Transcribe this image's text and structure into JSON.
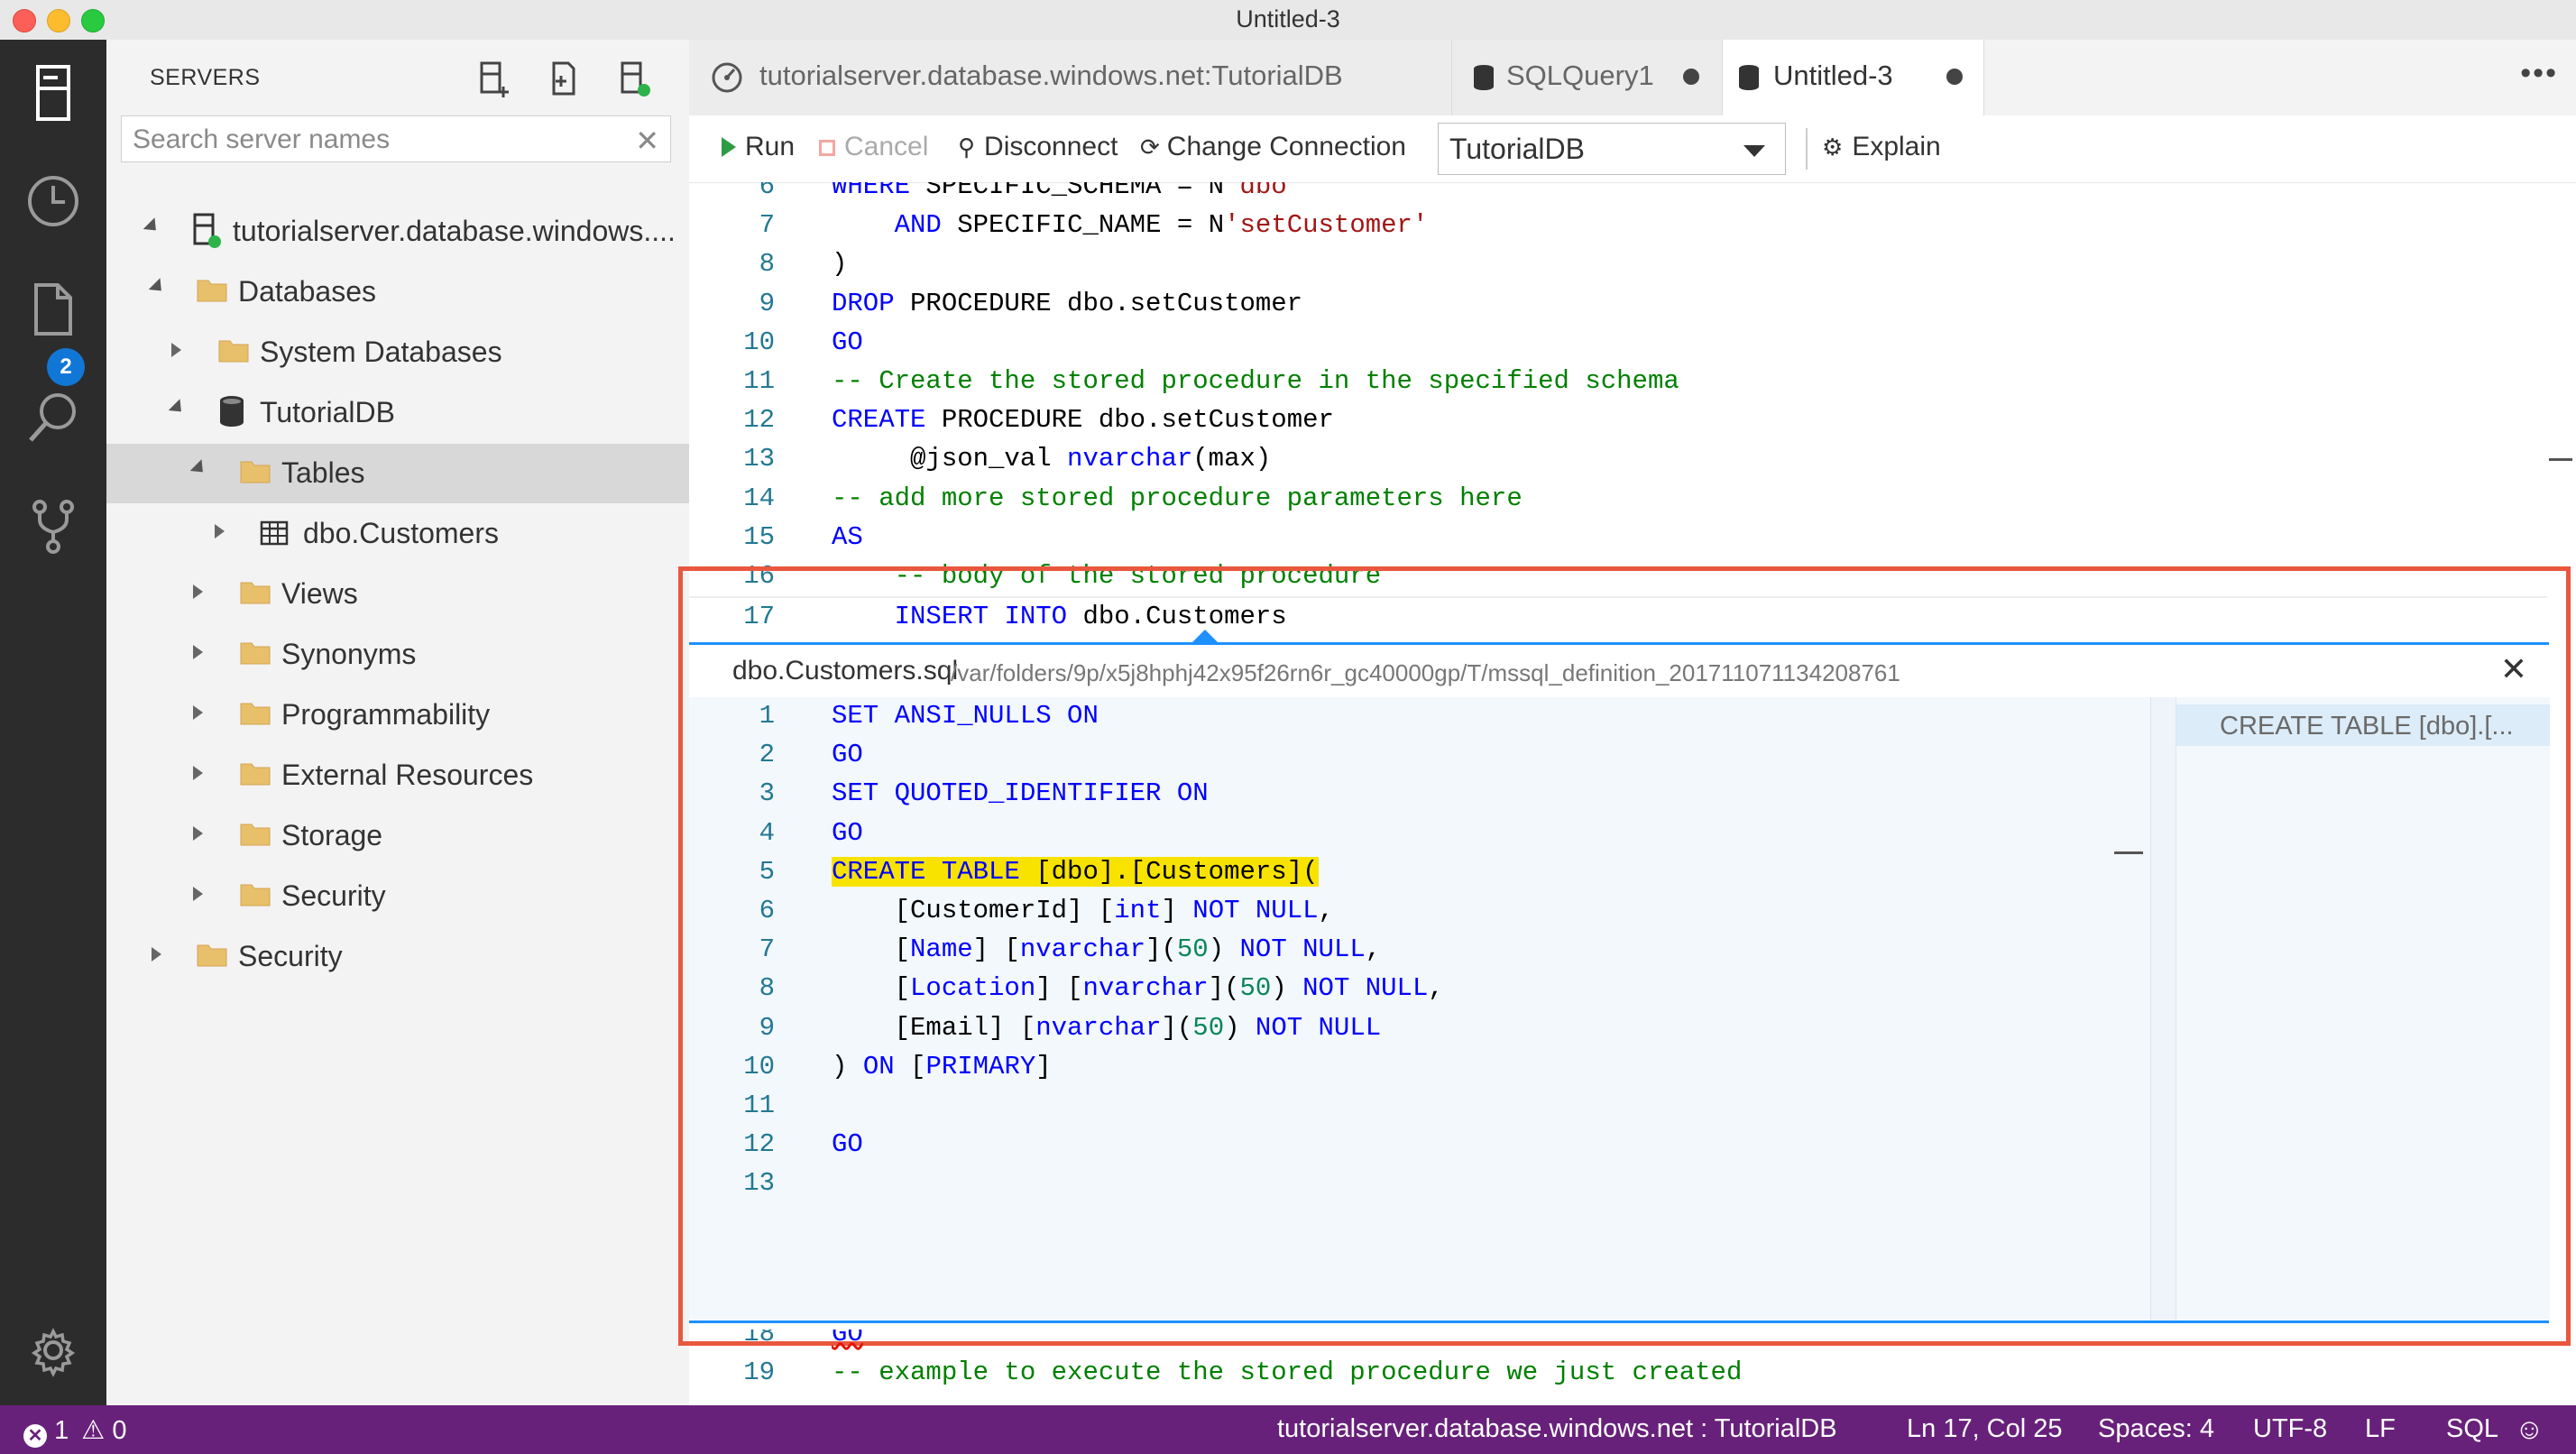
{
  "window": {
    "title": "Untitled-3"
  },
  "activity": {
    "badge": "2",
    "icons": [
      "servers-icon",
      "history-icon",
      "files-icon",
      "search-icon",
      "source-control-icon",
      "settings-gear-icon"
    ]
  },
  "sidebar": {
    "title": "SERVERS",
    "search_placeholder": "Search server names",
    "tree": [
      {
        "label": "tutorialserver.database.windows....",
        "icon": "server-connected-icon"
      },
      {
        "label": "Databases",
        "icon": "folder-icon"
      },
      {
        "label": "System Databases",
        "icon": "folder-icon"
      },
      {
        "label": "TutorialDB",
        "icon": "database-icon"
      },
      {
        "label": "Tables",
        "icon": "folder-icon"
      },
      {
        "label": "dbo.Customers",
        "icon": "table-icon"
      },
      {
        "label": "Views",
        "icon": "folder-icon"
      },
      {
        "label": "Synonyms",
        "icon": "folder-icon"
      },
      {
        "label": "Programmability",
        "icon": "folder-icon"
      },
      {
        "label": "External Resources",
        "icon": "folder-icon"
      },
      {
        "label": "Storage",
        "icon": "folder-icon"
      },
      {
        "label": "Security",
        "icon": "folder-icon"
      },
      {
        "label": "Security",
        "icon": "folder-icon"
      }
    ]
  },
  "tabs": [
    {
      "label": "tutorialserver.database.windows.net:TutorialDB",
      "icon": "dashboard-icon"
    },
    {
      "label": "SQLQuery1",
      "icon": "database-icon",
      "dirty": true
    },
    {
      "label": "Untitled-3",
      "icon": "database-icon",
      "dirty": true,
      "active": true
    }
  ],
  "toolbar": {
    "run": "Run",
    "cancel": "Cancel",
    "disconnect": "Disconnect",
    "change_connection": "Change Connection",
    "database": "TutorialDB",
    "explain": "Explain"
  },
  "editor_top": [
    {
      "n": "6",
      "parts": [
        [
          "kw",
          "WHERE "
        ],
        [
          "plain",
          "SPECIFIC_SCHEMA = N"
        ],
        [
          "str",
          "'dbo'"
        ]
      ]
    },
    {
      "n": "7",
      "parts": [
        [
          "plain",
          "    "
        ],
        [
          "kw",
          "AND "
        ],
        [
          "plain",
          "SPECIFIC_NAME = N"
        ],
        [
          "str",
          "'setCustomer'"
        ]
      ]
    },
    {
      "n": "8",
      "parts": [
        [
          "plain",
          ")"
        ]
      ]
    },
    {
      "n": "9",
      "parts": [
        [
          "kw",
          "DROP "
        ],
        [
          "plain",
          "PROCEDURE dbo.setCustomer"
        ]
      ]
    },
    {
      "n": "10",
      "parts": [
        [
          "kw",
          "GO"
        ]
      ]
    },
    {
      "n": "11",
      "parts": [
        [
          "cm",
          "-- Create the stored procedure in the specified schema"
        ]
      ]
    },
    {
      "n": "12",
      "parts": [
        [
          "kw",
          "CREATE "
        ],
        [
          "plain",
          "PROCEDURE dbo.setCustomer"
        ]
      ]
    },
    {
      "n": "13",
      "parts": [
        [
          "plain",
          "     @json_val "
        ],
        [
          "kw",
          "nvarchar"
        ],
        [
          "plain",
          "(max)"
        ]
      ]
    },
    {
      "n": "14",
      "parts": [
        [
          "cm",
          "-- add more stored procedure parameters here"
        ]
      ]
    },
    {
      "n": "15",
      "parts": [
        [
          "kw",
          "AS"
        ]
      ]
    },
    {
      "n": "16",
      "parts": [
        [
          "cm",
          "    -- body of the stored procedure"
        ]
      ]
    },
    {
      "n": "17",
      "parts": [
        [
          "plain",
          "    "
        ],
        [
          "kw",
          "INSERT INTO "
        ],
        [
          "plain",
          "dbo.Customers"
        ]
      ]
    }
  ],
  "peek": {
    "file": "dbo.Customers.sql",
    "path": "/var/folders/9p/x5j8hphj42x95f26rn6r_gc40000gp/T/mssql_definition_201711071134208761",
    "reference": "CREATE TABLE [dbo].[...",
    "lines": [
      {
        "n": "1",
        "parts": [
          [
            "kw",
            "SET ANSI_NULLS ON"
          ]
        ]
      },
      {
        "n": "2",
        "parts": [
          [
            "kw",
            "GO"
          ]
        ]
      },
      {
        "n": "3",
        "parts": [
          [
            "kw",
            "SET QUOTED_IDENTIFIER ON"
          ]
        ]
      },
      {
        "n": "4",
        "parts": [
          [
            "kw",
            "GO"
          ]
        ]
      },
      {
        "n": "5",
        "hl": true,
        "parts": [
          [
            "kw",
            "CREATE TABLE "
          ],
          [
            "plain",
            "[dbo].[Customers]("
          ]
        ]
      },
      {
        "n": "6",
        "parts": [
          [
            "plain",
            "    [CustomerId] ["
          ],
          [
            "kw",
            "int"
          ],
          [
            "plain",
            "] "
          ],
          [
            "kw",
            "NOT NULL"
          ],
          [
            "plain",
            ","
          ]
        ]
      },
      {
        "n": "7",
        "parts": [
          [
            "plain",
            "    ["
          ],
          [
            "kw",
            "Name"
          ],
          [
            "plain",
            "] ["
          ],
          [
            "kw",
            "nvarchar"
          ],
          [
            "plain",
            "]("
          ],
          [
            "num",
            "50"
          ],
          [
            "plain",
            ") "
          ],
          [
            "kw",
            "NOT NULL"
          ],
          [
            "plain",
            ","
          ]
        ]
      },
      {
        "n": "8",
        "parts": [
          [
            "plain",
            "    ["
          ],
          [
            "kw",
            "Location"
          ],
          [
            "plain",
            "] ["
          ],
          [
            "kw",
            "nvarchar"
          ],
          [
            "plain",
            "]("
          ],
          [
            "num",
            "50"
          ],
          [
            "plain",
            ") "
          ],
          [
            "kw",
            "NOT NULL"
          ],
          [
            "plain",
            ","
          ]
        ]
      },
      {
        "n": "9",
        "parts": [
          [
            "plain",
            "    [Email] ["
          ],
          [
            "kw",
            "nvarchar"
          ],
          [
            "plain",
            "]("
          ],
          [
            "num",
            "50"
          ],
          [
            "plain",
            ") "
          ],
          [
            "kw",
            "NOT NULL"
          ]
        ]
      },
      {
        "n": "10",
        "parts": [
          [
            "plain",
            ") "
          ],
          [
            "kw",
            "ON "
          ],
          [
            "plain",
            "["
          ],
          [
            "kw",
            "PRIMARY"
          ],
          [
            "plain",
            "]"
          ]
        ]
      },
      {
        "n": "11",
        "parts": []
      },
      {
        "n": "12",
        "parts": [
          [
            "kw",
            "GO"
          ]
        ]
      },
      {
        "n": "13",
        "parts": []
      }
    ]
  },
  "editor_bottom": [
    {
      "n": "18",
      "parts": [
        [
          "kw",
          "GO"
        ]
      ]
    },
    {
      "n": "19",
      "parts": [
        [
          "cm",
          "-- example to execute the stored procedure we just created"
        ]
      ]
    }
  ],
  "status": {
    "errors": "1",
    "warnings": "0",
    "connection": "tutorialserver.database.windows.net : TutorialDB",
    "position": "Ln 17, Col 25",
    "spaces": "Spaces: 4",
    "encoding": "UTF-8",
    "eol": "LF",
    "language": "SQL"
  },
  "colors": {
    "statusbar": "#68217a",
    "peek_border": "#e9573f",
    "highlight": "#f8e300",
    "badge": "#1177d6"
  }
}
